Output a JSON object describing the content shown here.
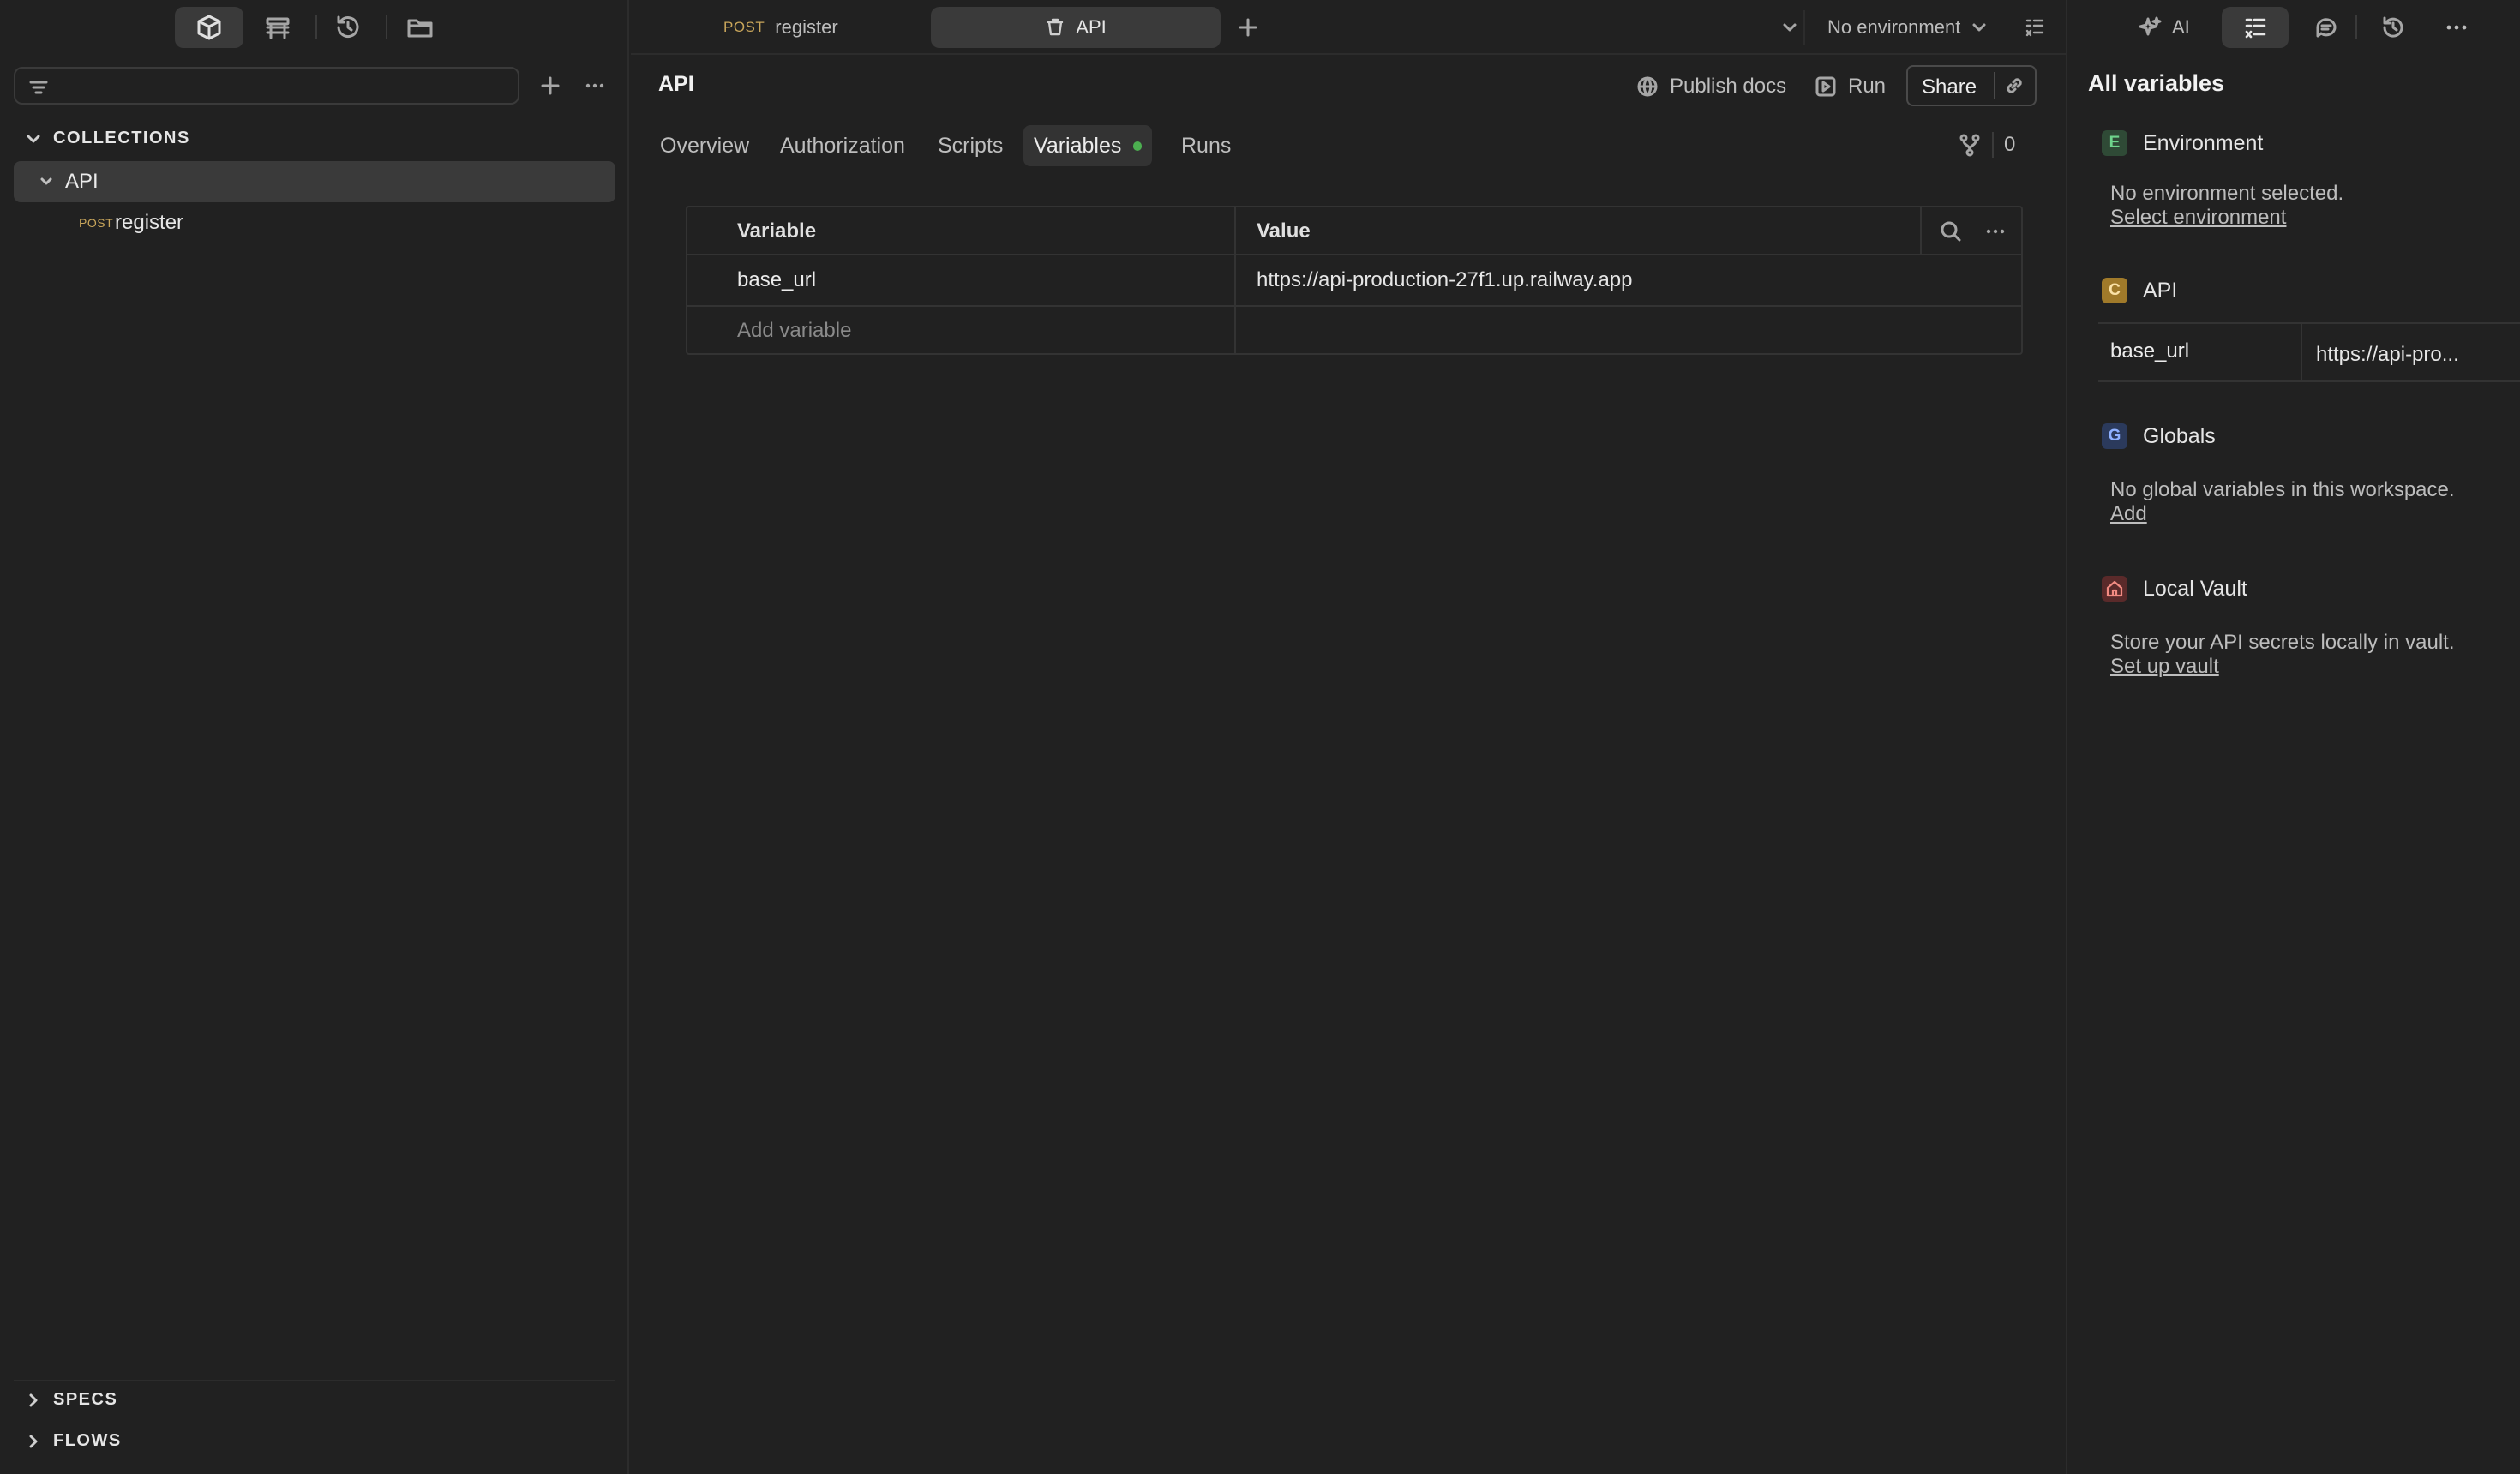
{
  "left_sidebar": {
    "toolbar_icons": [
      "collections-icon",
      "environments-icon",
      "history-icon",
      "files-icon"
    ],
    "sections": {
      "collections": "COLLECTIONS",
      "specs": "SPECS",
      "flows": "FLOWS"
    },
    "tree": {
      "collection_name": "API",
      "request": {
        "method": "POST",
        "name": "register"
      }
    }
  },
  "tabs": [
    {
      "method": "POST",
      "label": "register",
      "unsaved": true
    },
    {
      "label": "API",
      "active": true
    }
  ],
  "topbar": {
    "environment": "No environment"
  },
  "main": {
    "title": "API",
    "actions": {
      "publish_docs": "Publish docs",
      "run": "Run",
      "share": "Share"
    },
    "fork_count": "0",
    "subtabs": [
      "Overview",
      "Authorization",
      "Scripts",
      "Variables",
      "Runs"
    ],
    "active_subtab": "Variables",
    "table": {
      "headers": {
        "variable": "Variable",
        "value": "Value"
      },
      "rows": [
        {
          "variable": "base_url",
          "value": "https://api-production-27f1.up.railway.app"
        }
      ],
      "add_placeholder": "Add variable"
    }
  },
  "right_panel": {
    "header": {
      "ai_label": "AI"
    },
    "title": "All variables",
    "environment": {
      "badge": "E",
      "label": "Environment",
      "message": "No environment selected.",
      "link": "Select environment"
    },
    "collection": {
      "badge": "C",
      "label": "API",
      "var_name": "base_url",
      "var_value": "https://api-pro..."
    },
    "globals": {
      "badge": "G",
      "label": "Globals",
      "message": "No global variables in this workspace.",
      "link": "Add"
    },
    "vault": {
      "label": "Local Vault",
      "message": "Store your API secrets locally in vault.",
      "link": "Set up vault"
    }
  },
  "colors": {
    "background": "#212121",
    "panel_active": "#3a3a3a",
    "accent_orange": "#e8734a",
    "variables_dot": "#4caf50",
    "badge_env": "#2f4a36",
    "badge_collection": "#a07a2a",
    "badge_globals": "#2b3a5c",
    "badge_vault": "#5a2a2a"
  }
}
